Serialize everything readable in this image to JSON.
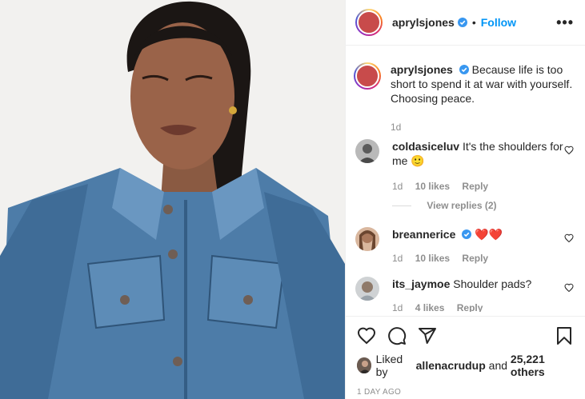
{
  "header": {
    "username": "aprylsjones",
    "dot": "•",
    "follow_label": "Follow",
    "more_label": "•••"
  },
  "caption": {
    "username": "aprylsjones",
    "text": "Because life is too short to spend it at war with yourself. Choosing peace.",
    "time": "1d"
  },
  "comments": [
    {
      "username": "coldasiceluv",
      "text": "It's the shoulders for me 🙂",
      "time": "1d",
      "likes": "10 likes",
      "reply": "Reply",
      "view_replies": "View replies (2)"
    },
    {
      "username": "breannerice",
      "text": "❤️❤️",
      "time": "1d",
      "likes": "10 likes",
      "reply": "Reply"
    },
    {
      "username": "its_jaymoe",
      "text": "Shoulder pads?",
      "time": "1d",
      "likes": "4 likes",
      "reply": "Reply"
    }
  ],
  "likes": {
    "prefix": "Liked by",
    "user": "allenacrudup",
    "and": "and",
    "count": "25,221 others"
  },
  "timestamp": "1 DAY AGO",
  "colors": {
    "accent": "#0095f6",
    "verified": "#3897f0",
    "heart": "#ed4956",
    "muted": "#8e8e8e"
  }
}
